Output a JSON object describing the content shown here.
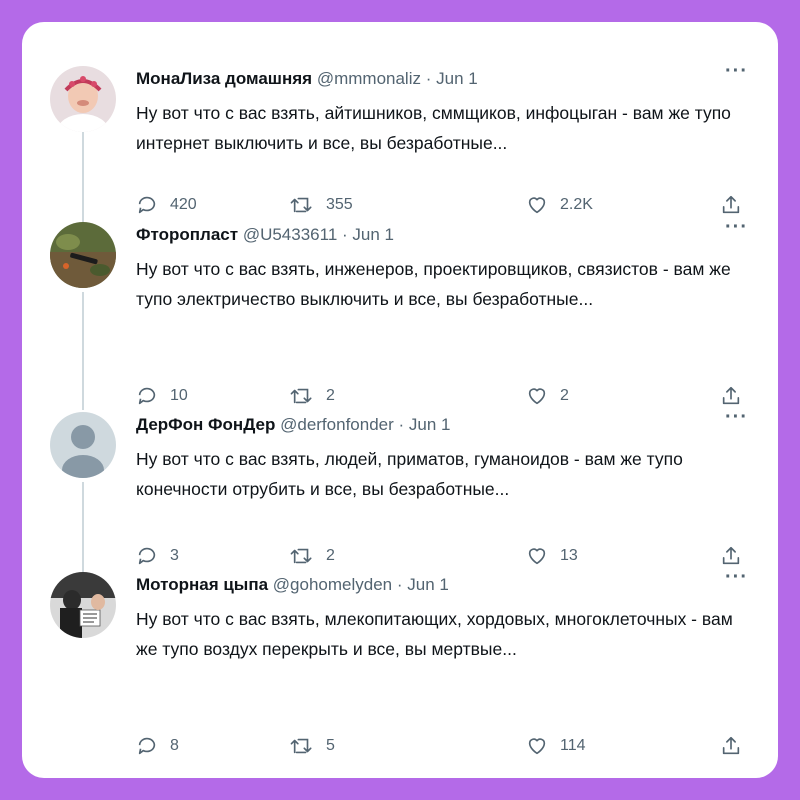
{
  "tweets": [
    {
      "name": "МонаЛиза домашняя",
      "handle": "@mmmonaliz",
      "date": "Jun 1",
      "text": "Ну вот что с вас взять, айтишников, сммщиков, инфоцыган - вам же тупо интернет выключить и все, вы безработные...",
      "replies": "420",
      "retweets": "355",
      "likes": "2.2K",
      "avatar_icon": "woman-photo-avatar"
    },
    {
      "name": "Фторопласт",
      "handle": "@U5433611",
      "date": "Jun 1",
      "text": "Ну вот что с вас взять, инженеров, проектировщиков, связистов - вам же тупо электричество выключить и все, вы безработные...",
      "replies": "10",
      "retweets": "2",
      "likes": "2",
      "avatar_icon": "nature-photo-avatar"
    },
    {
      "name": "ДерФон ФонДер",
      "handle": "@derfonfonder",
      "date": "Jun 1",
      "text": "Ну вот что с вас взять, людей, приматов, гуманоидов - вам же тупо конечности отрубить и все, вы безработные...",
      "replies": "3",
      "retweets": "2",
      "likes": "13",
      "avatar_icon": "default-person-avatar"
    },
    {
      "name": "Моторная цыпа",
      "handle": "@gohomelyden",
      "date": "Jun 1",
      "text": "Ну вот что с вас взять, млекопитающих, хордовых, многоклеточных - вам же тупо воздух перекрыть и все, вы мертвые...",
      "replies": "8",
      "retweets": "5",
      "likes": "114",
      "avatar_icon": "meme-photo-avatar"
    }
  ],
  "colors": {
    "background": "#b46ae8",
    "card": "#ffffff",
    "text": "#0f1419",
    "muted": "#536471",
    "thread_line": "#cfd9de"
  }
}
